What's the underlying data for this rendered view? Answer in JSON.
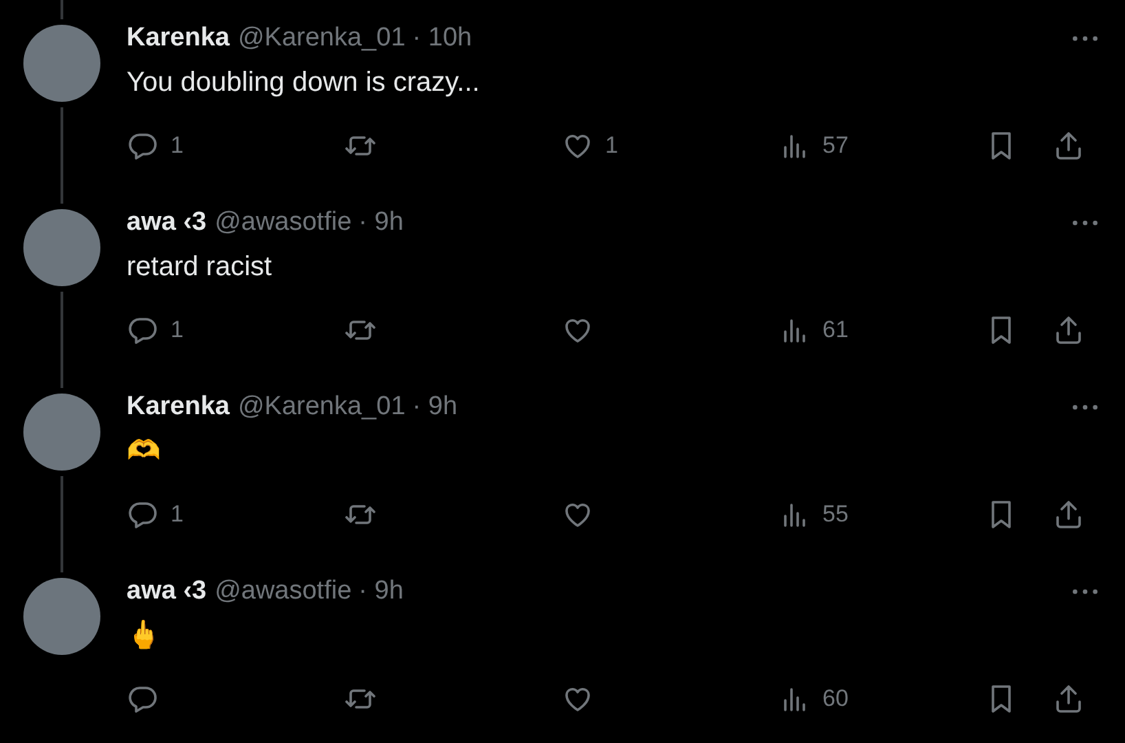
{
  "tweets": [
    {
      "name": "Karenka",
      "handle": "@Karenka_01",
      "time": "· 10h",
      "text": "You doubling down is crazy...",
      "reply_count": "1",
      "like_count": "1",
      "views": "57"
    },
    {
      "name": "awa ‹3",
      "handle": "@awasotfie",
      "time": "· 9h",
      "text": "retard racist",
      "reply_count": "1",
      "views": "61"
    },
    {
      "name": "Karenka",
      "handle": "@Karenka_01",
      "time": "· 9h",
      "text": "🫶",
      "reply_count": "1",
      "views": "55"
    },
    {
      "name": "awa ‹3",
      "handle": "@awasotfie",
      "time": "· 9h",
      "text": "🖕",
      "views": "60"
    }
  ]
}
